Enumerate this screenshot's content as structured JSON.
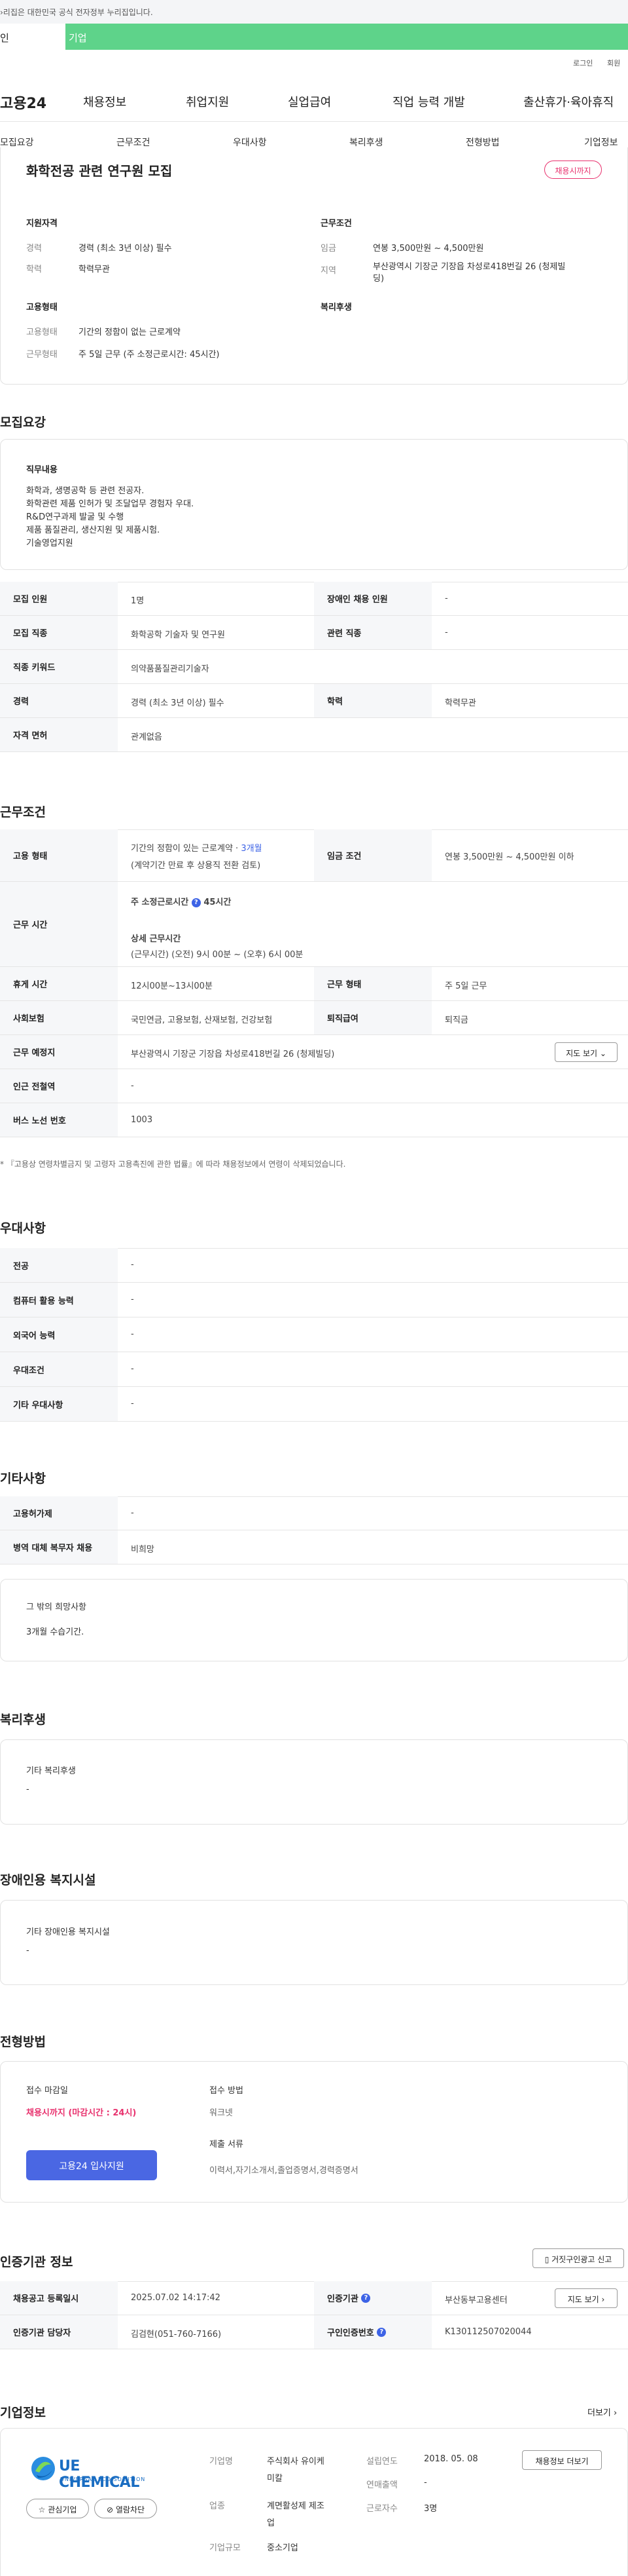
{
  "gov_notice": "›리집은 대한민국 공식 전자정부 누리집입니다.",
  "tabs": {
    "personal": "인",
    "business": "기업"
  },
  "util": {
    "login": "로그인",
    "signup": "회원"
  },
  "gnb": {
    "logo": "고용24",
    "items": [
      "채용정보",
      "취업지원",
      "실업급여",
      "직업 능력 개발",
      "출산휴가·육아휴직"
    ]
  },
  "subnav": [
    "모집요강",
    "근무조건",
    "우대사항",
    "복리후생",
    "전형방법",
    "기업정보"
  ],
  "summary": {
    "title": "화학전공 관련 연구원 모집",
    "badge": "채용시까지",
    "qual_h": "지원자격",
    "qual_k1": "경력",
    "qual_v1": "경력 (최소 3년 이상) 필수",
    "qual_k2": "학력",
    "qual_v2": "학력무관",
    "cond_h": "근무조건",
    "cond_k1": "임금",
    "cond_v1": "연봉 3,500만원 ~ 4,500만원",
    "cond_k2": "지역",
    "cond_v2a": "부산광역시 기장군 기장읍 차성로418번길 26 (청제빌",
    "cond_v2b": "딩)",
    "emp_h": "고용형태",
    "emp_k1": "고용형태",
    "emp_v1": "기간의 정함이 없는 근로계약",
    "emp_k2": "근무형태",
    "emp_v2": "주 5일 근무 (주 소정근로시간: 45시간)",
    "welfare_h": "복리후생"
  },
  "recruit": {
    "heading": "모집요강",
    "duty_h": "직무내용",
    "duty_text": "화학과, 생명공학 등 관련 전공자.\n화학관련 제품 인허가 및 조달업무 경험자 우대.\nR&D연구과제 발굴 및 수행\n제품 품질관리, 생산지원 및 제품시험.\n기술영업지원",
    "rows": [
      {
        "k1": "모집 인원",
        "v1": "1명",
        "k2": "장애인 채용 인원",
        "v2": "-"
      },
      {
        "k1": "모집 직종",
        "v1": "화학공학 기술자 및 연구원",
        "k2": "관련 직종",
        "v2": "-"
      },
      {
        "k1": "직종 키워드",
        "v1": "의약품품질관리기술자"
      },
      {
        "k1": "경력",
        "v1": "경력 (최소 3년 이상) 필수",
        "k2": "학력",
        "v2": "학력무관"
      },
      {
        "k1": "자격 면허",
        "v1": "관계없음"
      }
    ]
  },
  "work": {
    "heading": "근무조건",
    "emp_k": "고용 형태",
    "emp_v1": "기간의 정함이 있는 근로계약 · ",
    "emp_v1_hl": "3개월",
    "emp_v2": "(계약기간 만료 후 상용직 전환 검토)",
    "wage_k": "임금 조건",
    "wage_v": "연봉 3,500만원 ~ 4,500만원 이하",
    "time_k": "근무 시간",
    "time_l1": "주 소정근로시간",
    "time_l1b": "45시간",
    "time_l2": "상세 근무시간",
    "time_l3": "(근무시간) (오전) 9시 00분 ~ (오후) 6시 00분",
    "rest_k": "휴게 시간",
    "rest_v": "12시00분~13시00분",
    "form_k": "근무 형태",
    "form_v": "주 5일 근무",
    "ins_k": "사회보험",
    "ins_v": "국민연금, 고용보험, 산재보험, 건강보험",
    "sev_k": "퇴직급여",
    "sev_v": "퇴직금",
    "place_k": "근무 예정지",
    "place_v": "부산광역시 기장군 기장읍 차성로418번길 26 (청제빌딩)",
    "map_btn": "지도 보기",
    "subway_k": "인근 전철역",
    "subway_v": "-",
    "bus_k": "버스 노선 번호",
    "bus_v": "1003",
    "note": "* 『고용상 연령차별금지 및 고령자 고용촉진에 관한 법률』에 따라 채용정보에서 연령이 삭제되었습니다."
  },
  "pref": {
    "heading": "우대사항",
    "rows": [
      {
        "k": "전공",
        "v": "-"
      },
      {
        "k": "컴퓨터 활용 능력",
        "v": "-"
      },
      {
        "k": "외국어 능력",
        "v": "-"
      },
      {
        "k": "우대조건",
        "v": "-"
      },
      {
        "k": "기타 우대사항",
        "v": "-"
      }
    ]
  },
  "etc": {
    "heading": "기타사항",
    "rows": [
      {
        "k": "고용허가제",
        "v": "-"
      },
      {
        "k": "병역 대체 복무자 채용",
        "v": "비희망"
      }
    ],
    "hope_h": "그 밖의 희망사항",
    "hope_v": "3개월 수습기간."
  },
  "welfare": {
    "heading": "복리후생",
    "h": "기타 복리후생",
    "v": "-"
  },
  "disabled": {
    "heading": "장애인용 복지시설",
    "h": "기타 장애인용 복지시설",
    "v": "-"
  },
  "process": {
    "heading": "전형방법",
    "deadline_h": "접수 마감일",
    "deadline_v": "채용시까지 (마감시간 : 24시)",
    "method_h": "접수 방법",
    "method_v": "워크넷",
    "docs_h": "제출 서류",
    "docs_v": "이력서,자기소개서,졸업증명서,경력증명서",
    "apply_btn": "고용24 입사지원"
  },
  "agency": {
    "heading": "인증기관 정보",
    "report_btn": "거짓구인광고 신고",
    "rows": [
      {
        "k1": "채용공고 등록일시",
        "v1": "2025.07.02 14:17:42",
        "k2": "인증기관",
        "v2": "부산동부고용센터",
        "btn": "지도 보기"
      },
      {
        "k1": "인증기관 담당자",
        "v1": "김검현(051-760-7166)",
        "k2": "구인인증번호",
        "v2": "K130112507020044"
      }
    ]
  },
  "company": {
    "heading": "기업정보",
    "more": "더보기",
    "logo_main": "UE CHEMICAL",
    "logo_sub": "UNIVERSAL ECO SOLUTION",
    "fav_btn": "관심기업",
    "block_btn": "열람차단",
    "name_k": "기업명",
    "name_v1": "주식회사 유이케",
    "name_v2": "미칼",
    "ind_k": "업종",
    "ind_v1": "계면활성제 제조",
    "ind_v2": "업",
    "size_k": "기업규모",
    "size_v": "중소기업",
    "year_k": "설립연도",
    "year_v": "2018. 05. 08",
    "sales_k": "연매출액",
    "sales_v": "-",
    "emp_k": "근로자수",
    "emp_v": "3명",
    "jobs_btn": "채용정보 더보기"
  }
}
